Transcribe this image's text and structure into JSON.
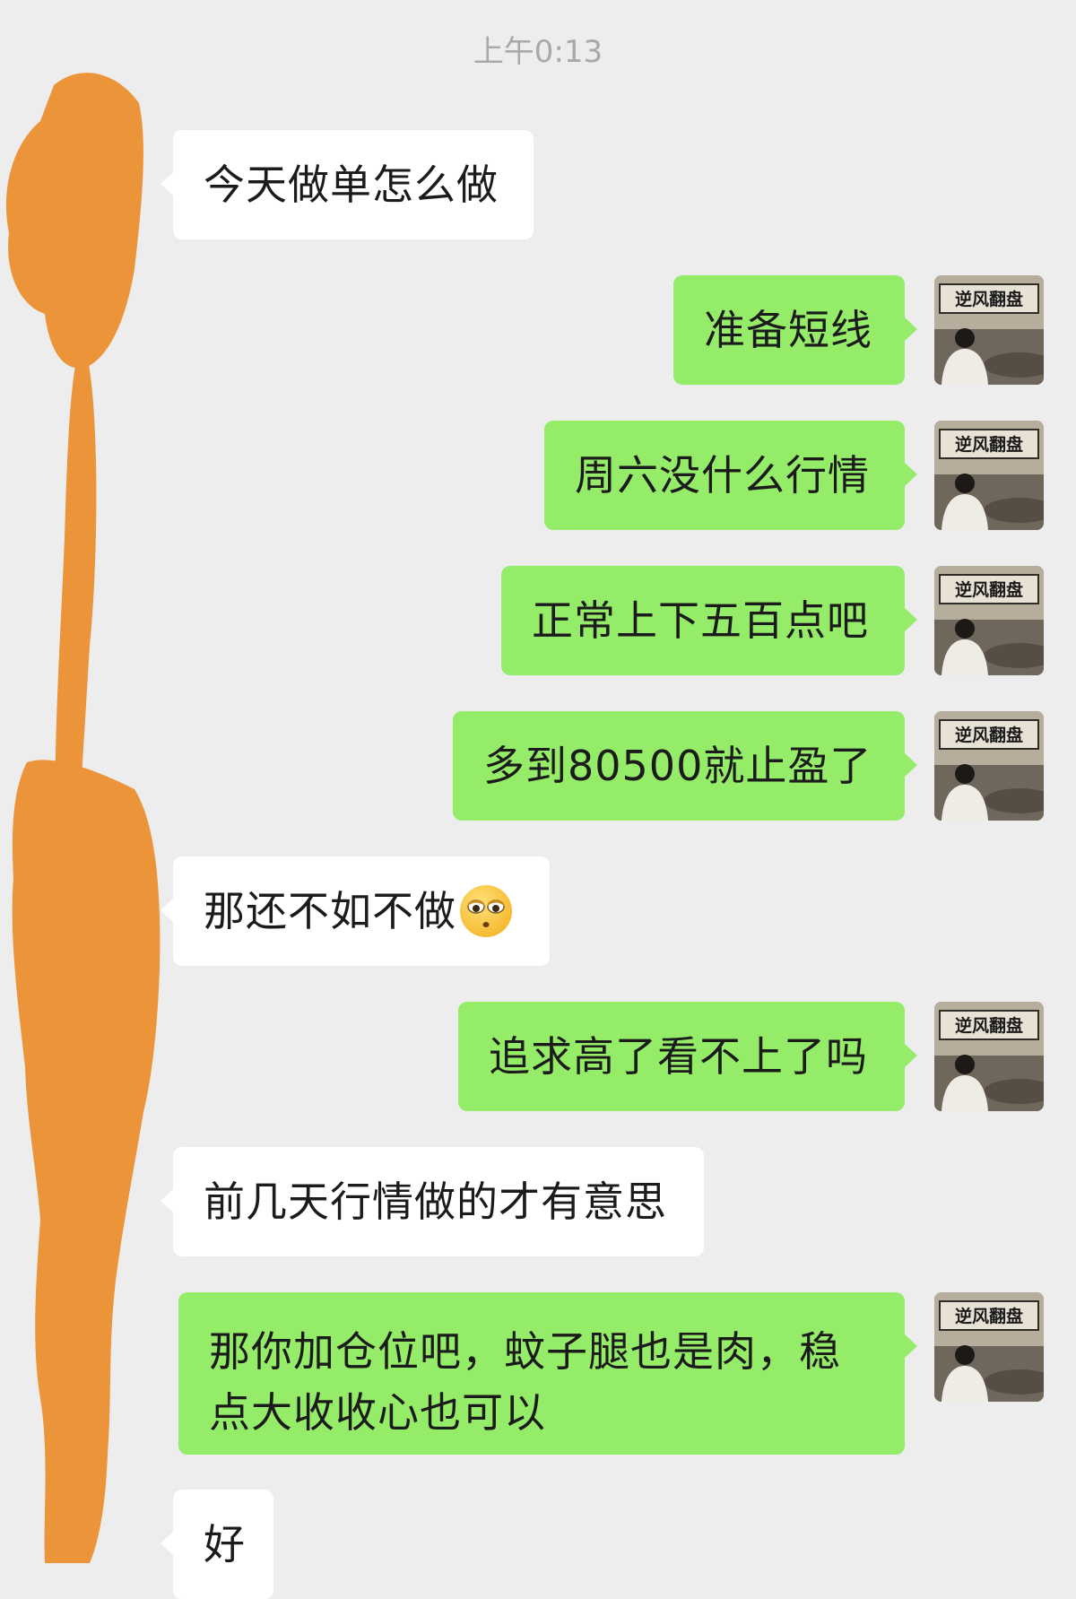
{
  "chat": {
    "timestamp": "上午0:13",
    "messages": [
      {
        "side": "in",
        "text": "今天做单怎么做"
      },
      {
        "side": "out",
        "text": "准备短线"
      },
      {
        "side": "out",
        "text": "周六没什么行情"
      },
      {
        "side": "out",
        "text": "正常上下五百点吧"
      },
      {
        "side": "out",
        "text": "多到80500就止盈了"
      },
      {
        "side": "in",
        "text": "那还不如不做",
        "emoji": "rolling-eyes-emoji"
      },
      {
        "side": "out",
        "text": "追求高了看不上了吗"
      },
      {
        "side": "in",
        "text": "前几天行情做的才有意思"
      },
      {
        "side": "out",
        "text": "那你加仓位吧，蚊子腿也是肉，稳点大收收心也可以"
      },
      {
        "side": "in",
        "text": "好"
      }
    ],
    "avatar_caption": "逆风翻盘",
    "colors": {
      "background": "#ededed",
      "incoming_bubble": "#ffffff",
      "outgoing_bubble": "#95ec69",
      "redaction": "#ec943a"
    },
    "redaction_note": "incoming avatars redacted with orange marker"
  }
}
